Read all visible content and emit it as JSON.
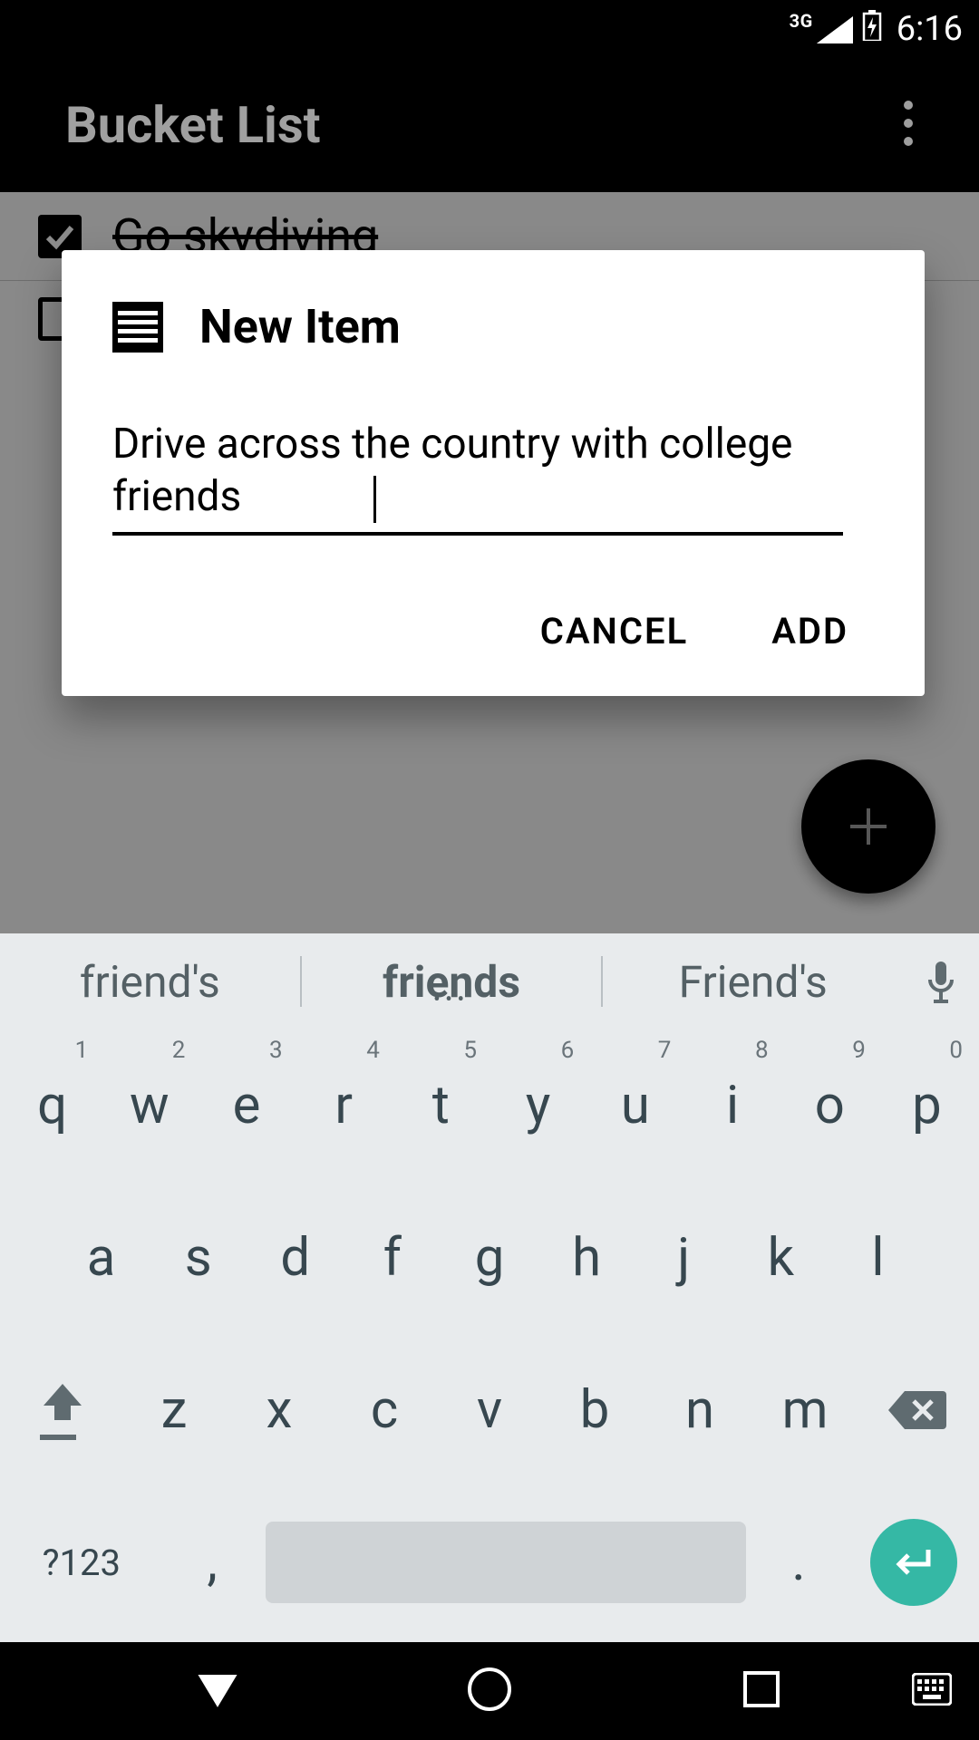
{
  "status": {
    "network_label": "3G",
    "time": "6:16"
  },
  "appbar": {
    "title": "Bucket List"
  },
  "list": {
    "items": [
      {
        "text": "Go skydiving",
        "checked": true
      }
    ]
  },
  "dialog": {
    "title": "New Item",
    "input_value": "Drive across the country with college friends",
    "cancel_label": "CANCEL",
    "add_label": "ADD"
  },
  "keyboard": {
    "suggestions": [
      "friend's",
      "friends",
      "Friend's"
    ],
    "row1": [
      {
        "k": "q",
        "h": "1"
      },
      {
        "k": "w",
        "h": "2"
      },
      {
        "k": "e",
        "h": "3"
      },
      {
        "k": "r",
        "h": "4"
      },
      {
        "k": "t",
        "h": "5"
      },
      {
        "k": "y",
        "h": "6"
      },
      {
        "k": "u",
        "h": "7"
      },
      {
        "k": "i",
        "h": "8"
      },
      {
        "k": "o",
        "h": "9"
      },
      {
        "k": "p",
        "h": "0"
      }
    ],
    "row2": [
      "a",
      "s",
      "d",
      "f",
      "g",
      "h",
      "j",
      "k",
      "l"
    ],
    "row3": [
      "z",
      "x",
      "c",
      "v",
      "b",
      "n",
      "m"
    ],
    "symbols_label": "?123",
    "comma": ",",
    "period": "."
  }
}
